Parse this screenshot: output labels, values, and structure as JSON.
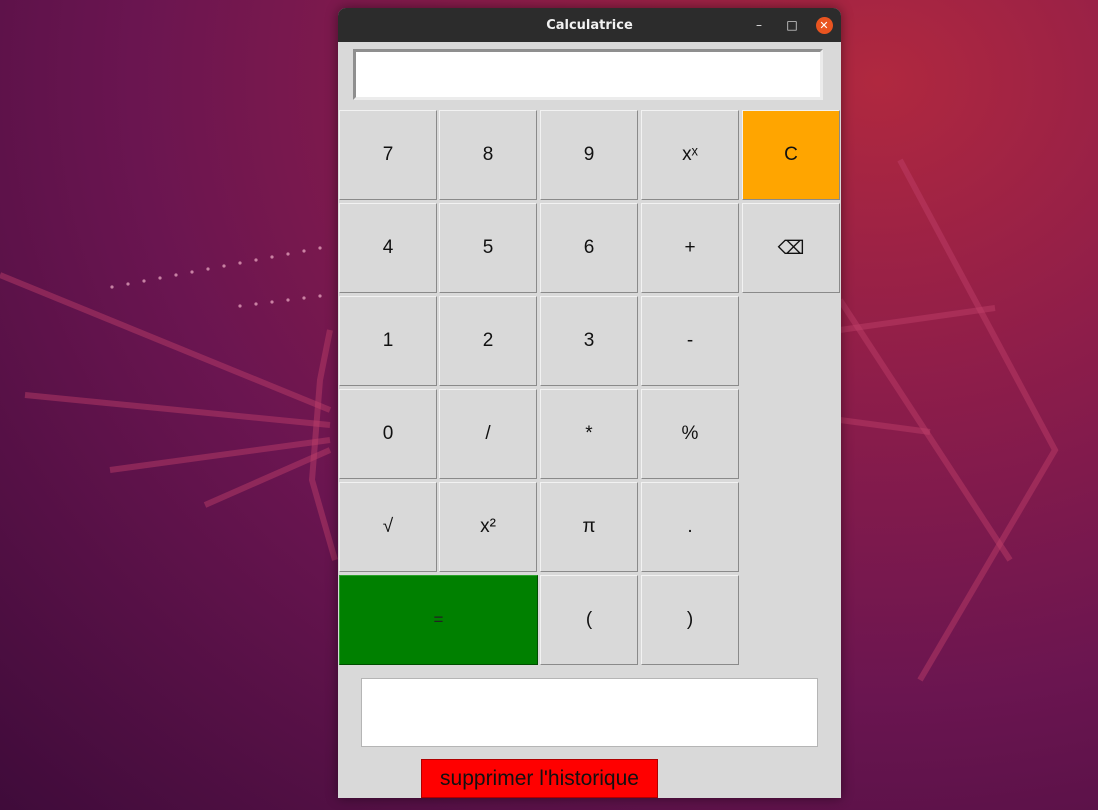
{
  "window": {
    "title": "Calculatrice",
    "minimize": "–",
    "maximize": "□",
    "close": "✕"
  },
  "display": {
    "value": ""
  },
  "keys": {
    "k7": "7",
    "k8": "8",
    "k9": "9",
    "kpow": "xˣ",
    "kclear": "C",
    "k4": "4",
    "k5": "5",
    "k6": "6",
    "kplus": "+",
    "kback": "⌫",
    "k1": "1",
    "k2": "2",
    "k3": "3",
    "kminus": "-",
    "k0": "0",
    "kdiv": "/",
    "kmul": "*",
    "kpct": "%",
    "ksqrt": "√",
    "ksq": "x²",
    "kpi": "π",
    "kdot": ".",
    "keq": "=",
    "klp": "(",
    "krp": ")"
  },
  "history": {
    "value": "",
    "clear_label": "supprimer l'historique"
  },
  "colors": {
    "clear_button": "#ffa500",
    "equals_button": "#008000",
    "clear_history_button": "#ff0000",
    "window_bg": "#d9d9d9",
    "close_dot": "#e95420"
  }
}
